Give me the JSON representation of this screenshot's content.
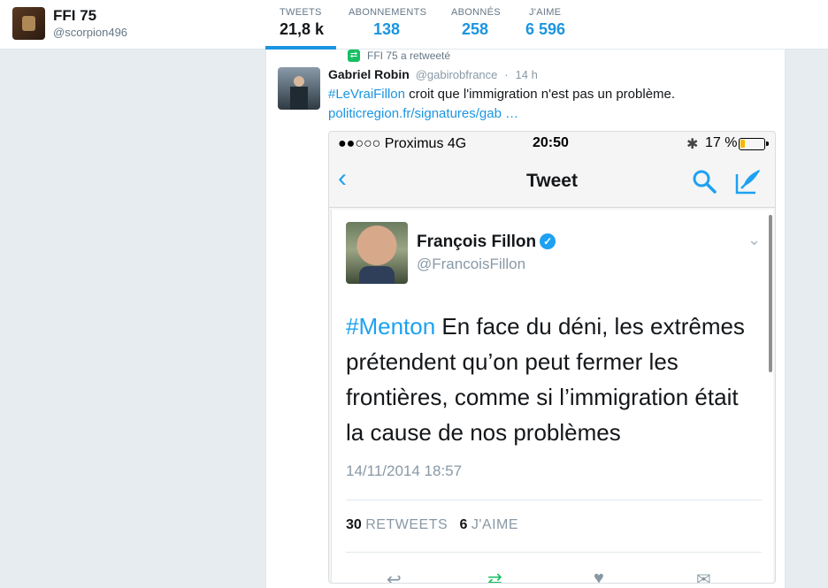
{
  "profile": {
    "name": "FFI 75",
    "handle": "@scorpion496"
  },
  "stats": [
    {
      "label": "TWEETS",
      "value": "21,8 k"
    },
    {
      "label": "ABONNEMENTS",
      "value": "138"
    },
    {
      "label": "ABONNÉS",
      "value": "258"
    },
    {
      "label": "J'AIME",
      "value": "6 596"
    }
  ],
  "retweet": {
    "text": "FFI 75 a retweeté"
  },
  "tweet": {
    "author": "Gabriel Robin",
    "handle": "@gabirobfrance",
    "separator": "·",
    "time": "14 h",
    "hashtag": "#LeVraiFillon",
    "text": " croit que l'immigration n'est pas un problème.",
    "link": "politicregion.fr/signatures/gab …"
  },
  "screenshot": {
    "status": {
      "signal": "●●○○○ Proximus   4G",
      "time": "20:50",
      "bluetooth": "✱",
      "battery": "17 %"
    },
    "nav": {
      "back": "‹",
      "title": "Tweet"
    },
    "author": "François Fillon",
    "verified": "✓",
    "handle": "@FrancoisFillon",
    "chevron": "⌄",
    "hashtag": "#Menton",
    "text": " En face du déni, les extrêmes prétendent qu’on peut fermer les frontières, comme si l’immigration était la cause de nos problèmes",
    "date": "14/11/2014 18:57",
    "retweets_count": "30",
    "retweets_label": "RETWEETS",
    "likes_count": "6",
    "likes_label": "J'AIME",
    "actions": [
      "↩",
      "⇄",
      "♥",
      "✉"
    ]
  }
}
